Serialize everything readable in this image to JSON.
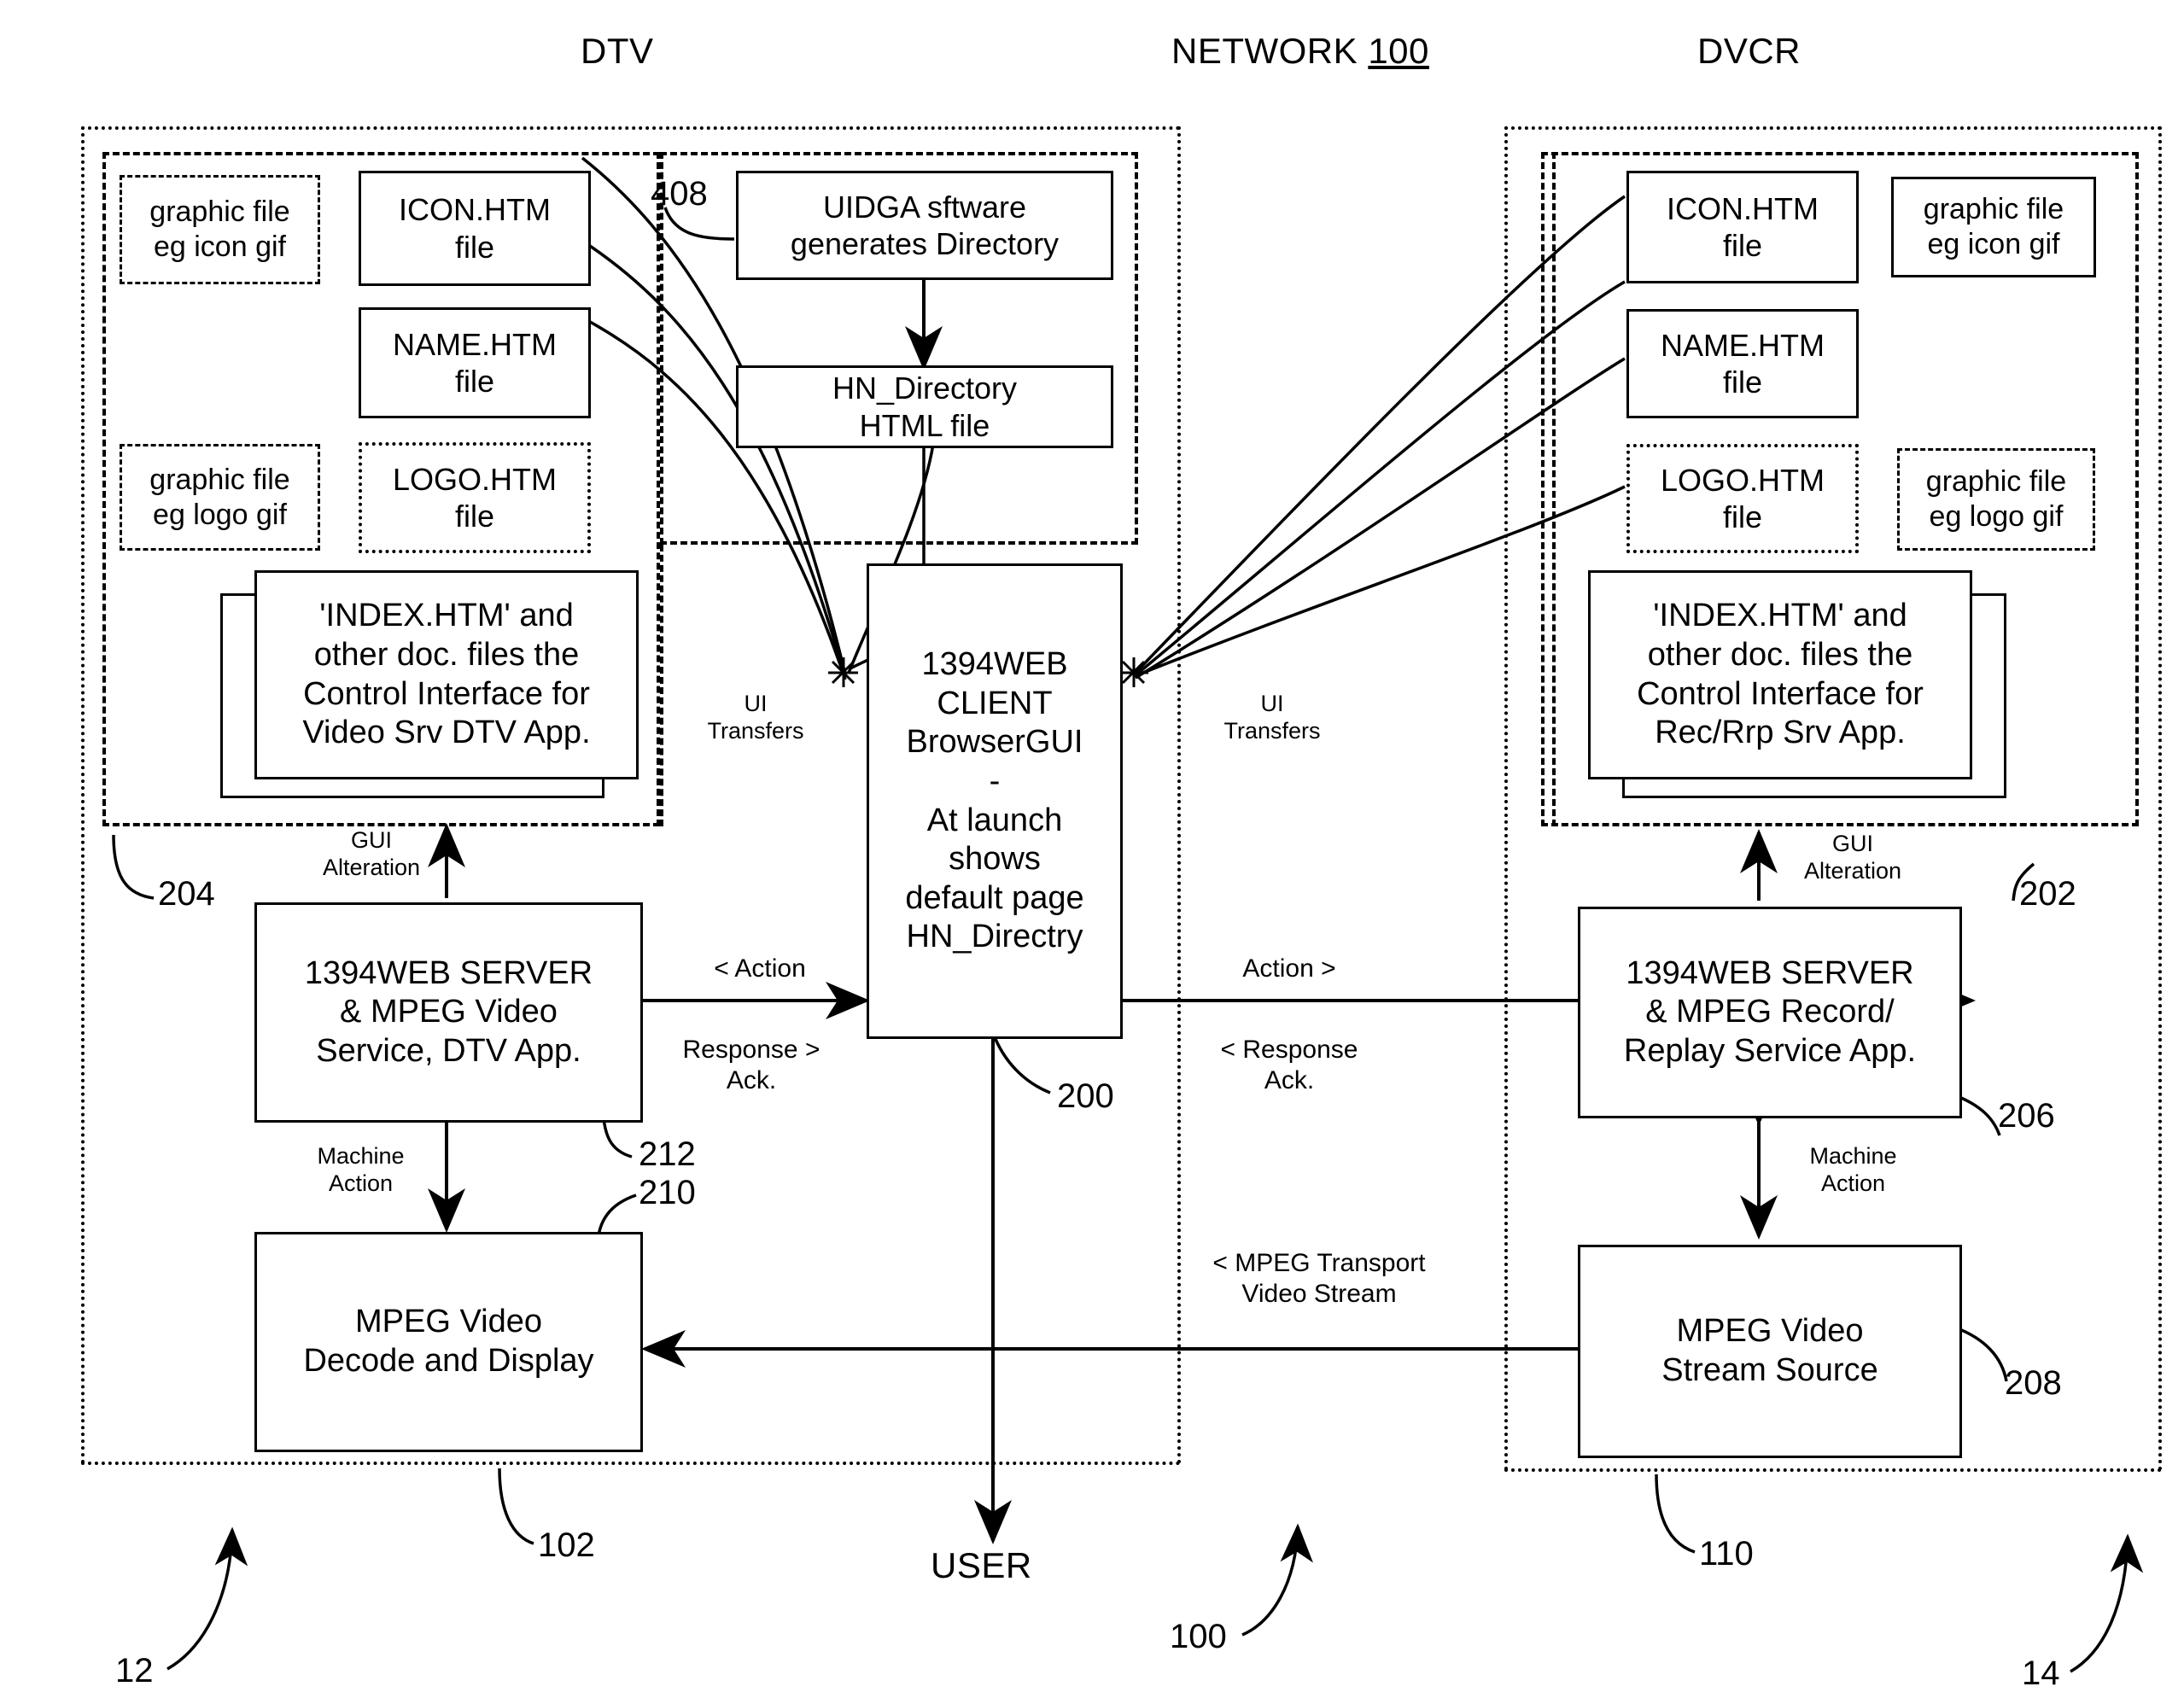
{
  "figure": {
    "titles": {
      "left_device": "DTV",
      "network_prefix": "NETWORK ",
      "network_number": "100",
      "right_device": "DVCR"
    },
    "reference_numbers": {
      "uidga": "408",
      "client": "200",
      "left_region": "204",
      "right_region": "202",
      "left_server": "212",
      "right_server": "206",
      "left_mpeg": "210",
      "right_mpeg": "208",
      "left_system": "102",
      "right_system": "110",
      "left_outer": "12",
      "right_outer": "14",
      "network": "100"
    },
    "left_panel": {
      "graphic_icon": "graphic file\neg icon gif",
      "icon_htm": "ICON.HTM\nfile",
      "name_htm": "NAME.HTM\nfile",
      "logo_htm": "LOGO.HTM\nfile",
      "graphic_logo": "graphic file\neg logo gif",
      "uidga_box": "UIDGA sftware\ngenerates Directory",
      "hn_directory_box": "HN_Directory\nHTML file",
      "index_box": "'INDEX.HTM' and\nother doc. files the\nControl Interface for\nVideo Srv DTV App.",
      "server_box": "1394WEB SERVER\n& MPEG Video\nService, DTV App.",
      "mpeg_box": "MPEG Video\nDecode and Display",
      "gui_alteration": "GUI\nAlteration",
      "machine_action": "Machine\nAction"
    },
    "right_panel": {
      "icon_htm": "ICON.HTM\nfile",
      "graphic_icon": "graphic file\neg icon gif",
      "name_htm": "NAME.HTM\nfile",
      "logo_htm": "LOGO.HTM\nfile",
      "graphic_logo": "graphic file\neg logo gif",
      "index_box": "'INDEX.HTM' and\nother doc. files the\nControl Interface for\nRec/Rrp Srv App.",
      "server_box": "1394WEB SERVER\n& MPEG Record/\nReplay Service App.",
      "mpeg_box": "MPEG Video\nStream Source",
      "gui_alteration": "GUI\nAlteration",
      "machine_action": "Machine\nAction"
    },
    "center": {
      "client_box": "1394WEB\nCLIENT\nBrowserGUI\n-\nAt launch\nshows\ndefault page\nHN_Directry",
      "user_label": "USER"
    },
    "connector_labels": {
      "left_ui_transfers": "UI\nTransfers",
      "right_ui_transfers": "UI\nTransfers",
      "left_action": "< Action",
      "left_response": "Response >\nAck.",
      "right_action": "Action >",
      "right_response": "< Response\nAck.",
      "mpeg_transport": "< MPEG Transport\nVideo Stream"
    }
  }
}
